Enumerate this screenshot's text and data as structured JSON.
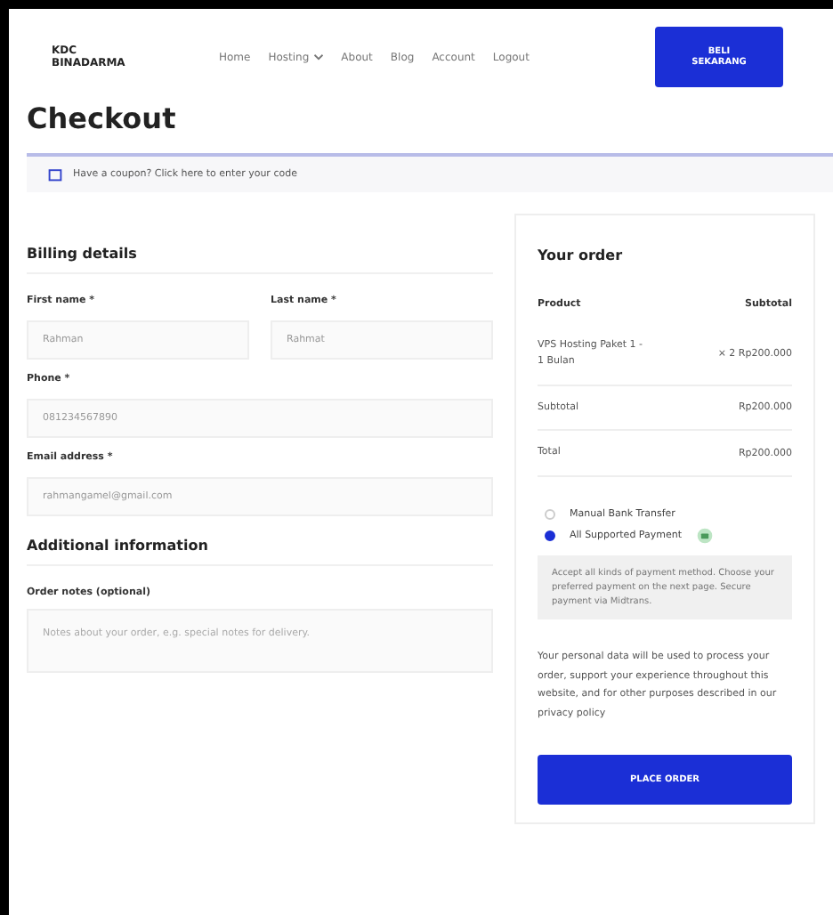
{
  "header": {
    "logo": [
      "KDC",
      "BINADARMA"
    ],
    "nav": [
      {
        "label": "Home",
        "dropdown": false
      },
      {
        "label": "Hosting",
        "dropdown": true
      },
      {
        "label": "About",
        "dropdown": false
      },
      {
        "label": "Blog",
        "dropdown": false
      },
      {
        "label": "Account",
        "dropdown": false
      },
      {
        "label": "Logout",
        "dropdown": false
      }
    ],
    "cta": [
      "BELI",
      "SEKARANG"
    ]
  },
  "title": "Checkout",
  "coupon": "Have a coupon? Click here to enter your code",
  "billing": {
    "heading": "Billing details",
    "fields": [
      {
        "label": "First name *",
        "value": "Rahman",
        "half": true
      },
      {
        "label": "Last name *",
        "value": "Rahmat",
        "half": true
      },
      {
        "label": "Phone *",
        "value": "081234567890",
        "half": false
      },
      {
        "label": "Email address *",
        "value": "rahmangamel@gmail.com",
        "half": false
      }
    ]
  },
  "additional": {
    "heading": "Additional information",
    "label": "Order notes (optional)",
    "placeholder": "Notes about your order, e.g. special notes for delivery."
  },
  "order": {
    "heading": "Your order",
    "columns": [
      "Product",
      "Subtotal"
    ],
    "rows": [
      {
        "kind": "item",
        "label": "VPS Hosting Paket 1 - 1 Bulan",
        "qty": "× 2",
        "amount": "Rp200.000"
      },
      {
        "kind": "total",
        "label": "Subtotal",
        "amount": "Rp200.000"
      },
      {
        "kind": "total",
        "label": "Total",
        "amount": "Rp200.000"
      }
    ],
    "payments": [
      {
        "label": "Manual Bank Transfer",
        "selected": false
      },
      {
        "label": "All Supported Payment",
        "selected": true,
        "description": "Accept all kinds of payment method. Choose your preferred payment on the next page. Secure payment via Midtrans."
      }
    ],
    "privacy": "Your personal data will be used to process your order, support your experience throughout this website, and for other purposes described in our",
    "privacy_link": "privacy policy",
    "button": "PLACE ORDER"
  }
}
